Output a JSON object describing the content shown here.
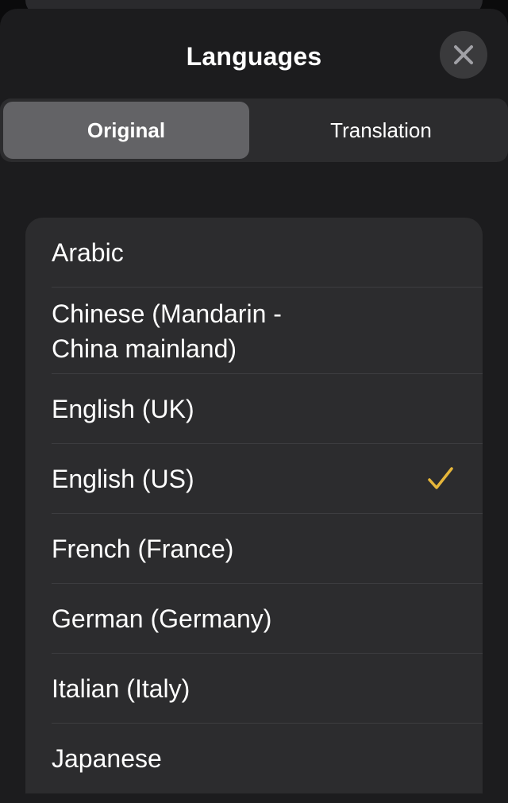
{
  "header": {
    "title": "Languages"
  },
  "tabs": [
    {
      "label": "Original",
      "selected": true
    },
    {
      "label": "Translation",
      "selected": false
    }
  ],
  "languages": [
    {
      "label": "Arabic",
      "selected": false
    },
    {
      "label": "Chinese (Mandarin - China mainland)",
      "selected": false
    },
    {
      "label": "English (UK)",
      "selected": false
    },
    {
      "label": "English (US)",
      "selected": true
    },
    {
      "label": "French (France)",
      "selected": false
    },
    {
      "label": "German (Germany)",
      "selected": false
    },
    {
      "label": "Italian (Italy)",
      "selected": false
    },
    {
      "label": "Japanese",
      "selected": false
    }
  ],
  "colors": {
    "accent": "#e6b63a",
    "sheet_bg": "#1c1c1e",
    "list_bg": "#2c2c2e",
    "selected_segment": "#636366"
  },
  "icons": {
    "close": "close-icon",
    "check": "checkmark-icon"
  }
}
